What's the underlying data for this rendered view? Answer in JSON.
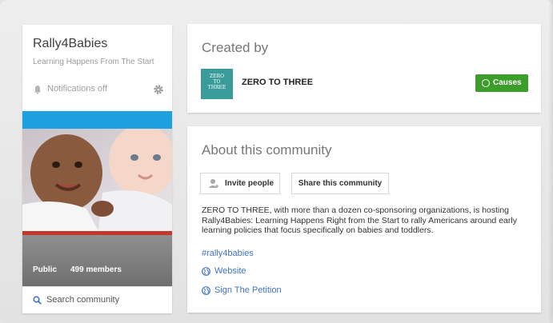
{
  "community": {
    "name": "Rally4Babies",
    "tagline": "Learning Happens From The Start",
    "notifications_label": "Notifications off",
    "visibility": "Public",
    "members": "499 members",
    "search_placeholder": "Search community"
  },
  "created_by": {
    "heading": "Created by",
    "org_name": "ZERO TO THREE",
    "logo_text": [
      "ZERO",
      "TO",
      "THREE"
    ],
    "causes_label": "Causes"
  },
  "about": {
    "heading": "About this community",
    "invite_label": "Invite people",
    "share_label": "Share this community",
    "description": "ZERO TO THREE, with more than a dozen co-sponsoring organizations, is hosting Rally4Babies: Learning Happens Right from the Start to rally Americans around early learning policies that focus specifically on babies and toddlers.",
    "hashtag": "#rally4babies",
    "links": [
      "Website",
      "Sign The Petition"
    ]
  },
  "colors": {
    "accent_blue": "#4273c8",
    "causes_green": "#3c9d2a",
    "cover_blue": "#1ea0e0",
    "logo_teal": "#3a9b9b"
  },
  "icons": [
    "bell-icon",
    "gear-icon",
    "search-icon",
    "invite-person-icon",
    "globe-icon",
    "circle-icon"
  ]
}
